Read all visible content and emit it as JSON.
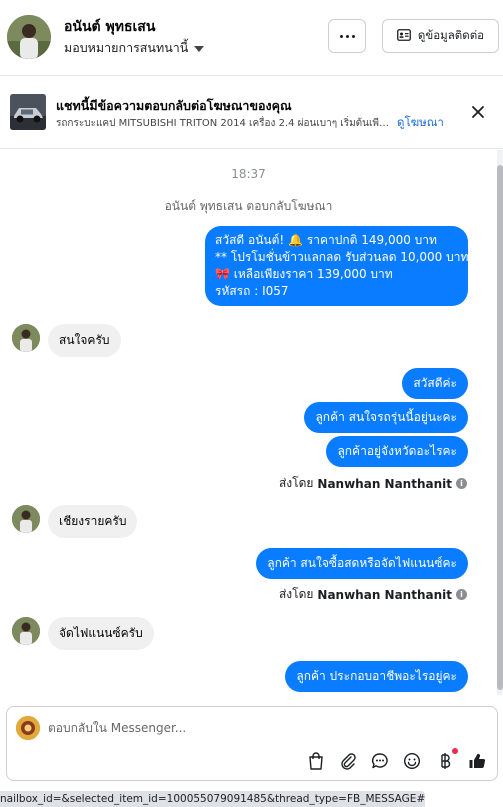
{
  "header": {
    "contact_name": "อนันต์ พุทธเสน",
    "assign_label": "มอบหมายการสนทนานี้",
    "contact_info_label": "ดูข้อมูลติดต่อ"
  },
  "ad_banner": {
    "title": "แชทนี้มีข้อความตอบกลับต่อโฆษณาของคุณ",
    "description": "รถกระบะแคป MITSUBISHI TRITON 2014 เครื่อง 2.4 ผ่อนเบาๆ เริ่มต้นเพียง...",
    "link_label": "ดูโฆษณา"
  },
  "chat": {
    "timestamp": "18:37",
    "system_note": "อนันต์ พุทธเสน ตอบกลับโฆษณา",
    "ad_reply": {
      "line1": "สวัสดี อนันต์! 🔔 ราคาปกติ 149,000 บาท",
      "line2": "** โปรโมชั่นข้าวแลกลด รับส่วนลด 10,000 บาท",
      "line3": "🎀 เหลือเพียงราคา 139,000 บาท",
      "line4": "รหัสรถ : I057"
    },
    "msg_in_1": "สนใจครับ",
    "msg_out_1": "สวัสดีค่ะ",
    "msg_out_2": "ลูกค้า สนใจรถรุ่นนี้อยู่นะคะ",
    "msg_out_3": "ลูกค้าอยู่จังหวัดอะไรคะ",
    "sent_by_prefix": "ส่งโดย",
    "sent_by_name": "Nanwhan Nanthanit",
    "msg_in_2": "เชียงรายครับ",
    "msg_out_4": "ลูกค้า สนใจซื้อสดหรือจัดไฟแนนซ์คะ",
    "msg_in_3": "จัดไฟแนนซ์ครับ",
    "msg_out_5": "ลูกค้า ประกอบอาชีพอะไรอยู่คะ"
  },
  "composer": {
    "placeholder": "ตอบกลับใน Messenger..."
  },
  "status_bar": {
    "url_text": "nailbox_id=&selected_item_id=100055079091485&thread_type=FB_MESSAGE#"
  },
  "colors": {
    "brand_blue": "#0a7cff",
    "incoming_bubble": "#f0f0f0",
    "link_blue": "#1a6ed8"
  },
  "icons": [
    "chevron-down-icon",
    "more-icon",
    "contact-card-icon",
    "close-icon",
    "info-icon",
    "shopping-bag-icon",
    "paperclip-icon",
    "saved-reply-icon",
    "emoji-icon",
    "payment-icon",
    "thumbs-up-icon"
  ]
}
